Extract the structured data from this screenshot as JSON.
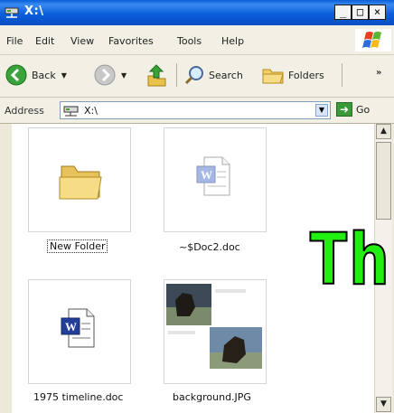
{
  "window": {
    "title": "X:\\"
  },
  "titlebar": {
    "min": "_",
    "max": "□",
    "close": "×"
  },
  "menu": [
    "File",
    "Edit",
    "View",
    "Favorites",
    "Tools",
    "Help"
  ],
  "toolbar": {
    "back": "Back",
    "search": "Search",
    "folders": "Folders",
    "more": "»"
  },
  "address": {
    "label": "Address",
    "value": "X:\\",
    "go": "Go"
  },
  "files": [
    {
      "name": "New Folder",
      "type": "folder",
      "selected": true
    },
    {
      "name": "~$Doc2.doc",
      "type": "word-doc-ghost"
    },
    {
      "name": "1975 timeline.doc",
      "type": "word-doc"
    },
    {
      "name": "background.JPG",
      "type": "image"
    }
  ],
  "overlay_text": "Th",
  "colors": {
    "titlebar": "#0a5fd8",
    "overlay": "#22ee11"
  }
}
